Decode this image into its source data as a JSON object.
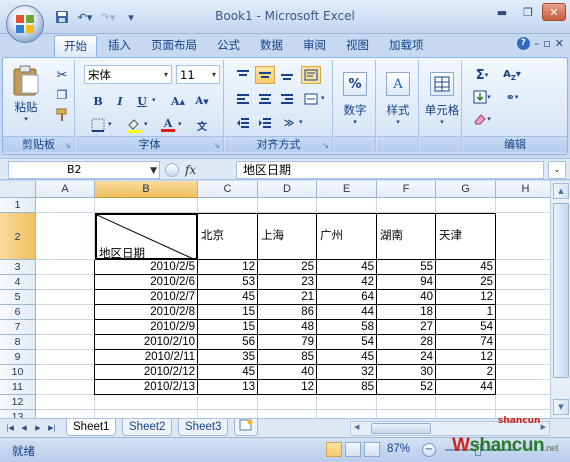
{
  "window": {
    "title": "Book1 - Microsoft Excel"
  },
  "tabs": [
    "开始",
    "插入",
    "页面布局",
    "公式",
    "数据",
    "审阅",
    "视图",
    "加载项"
  ],
  "ribbon": {
    "clipboard": {
      "label": "剪贴板",
      "paste": "粘贴"
    },
    "font": {
      "label": "字体",
      "name": "宋体",
      "size": "11"
    },
    "alignment": {
      "label": "对齐方式"
    },
    "number": {
      "label": "数字"
    },
    "styles": {
      "label": "样式"
    },
    "cells": {
      "label": "单元格"
    },
    "editing": {
      "label": "编辑"
    }
  },
  "formula_bar": {
    "name_box": "B2",
    "fx": "fx",
    "content": "地区日期"
  },
  "grid": {
    "columns": [
      "A",
      "B",
      "C",
      "D",
      "E",
      "F",
      "G",
      "H"
    ],
    "rows": [
      "1",
      "2",
      "3",
      "4",
      "5",
      "6",
      "7",
      "8",
      "9",
      "10",
      "11",
      "12",
      "13"
    ],
    "header_left": "地区",
    "header_right": "日期",
    "cities": [
      "北京",
      "上海",
      "广州",
      "湖南",
      "天津"
    ],
    "data": [
      [
        "2010/2/5",
        "12",
        "25",
        "45",
        "55",
        "45"
      ],
      [
        "2010/2/6",
        "53",
        "23",
        "42",
        "94",
        "25"
      ],
      [
        "2010/2/7",
        "45",
        "21",
        "64",
        "40",
        "12"
      ],
      [
        "2010/2/8",
        "15",
        "86",
        "44",
        "18",
        "1"
      ],
      [
        "2010/2/9",
        "15",
        "48",
        "58",
        "27",
        "54"
      ],
      [
        "2010/2/10",
        "56",
        "79",
        "54",
        "28",
        "74"
      ],
      [
        "2010/2/11",
        "35",
        "85",
        "45",
        "24",
        "12"
      ],
      [
        "2010/2/12",
        "45",
        "40",
        "32",
        "30",
        "2"
      ],
      [
        "2010/2/13",
        "13",
        "12",
        "85",
        "52",
        "44"
      ]
    ]
  },
  "sheets": [
    "Sheet1",
    "Sheet2",
    "Sheet3"
  ],
  "status": {
    "text": "就绪",
    "zoom": "87%"
  },
  "watermark": {
    "top": "shancun",
    "main_red": "W",
    "main_green": "shancun",
    "suffix": ".net"
  },
  "colors": {
    "accent": "#15428b",
    "selection": "#f8c96b",
    "ribbon_bg": "#dbe8f7"
  }
}
